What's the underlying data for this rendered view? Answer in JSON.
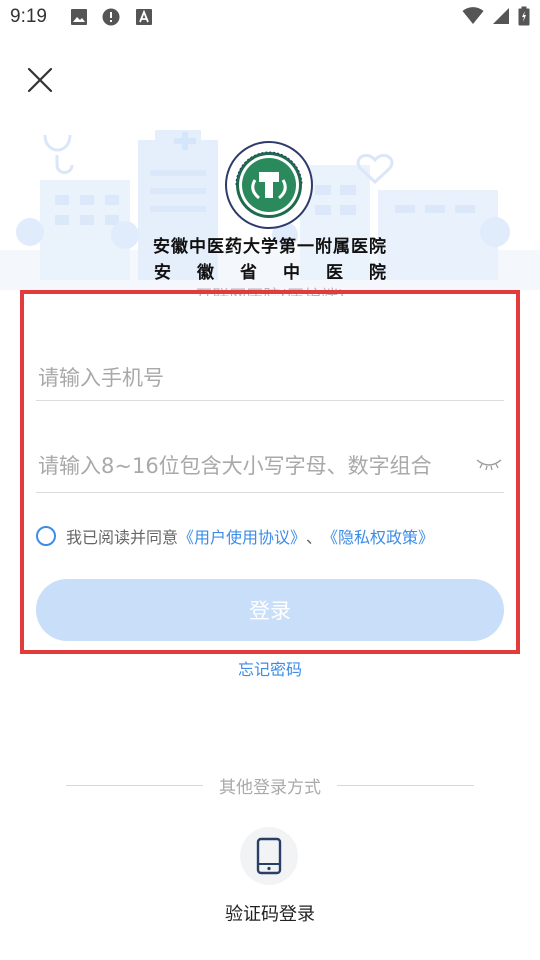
{
  "status_bar": {
    "time": "9:19",
    "left_icons": [
      "image-icon",
      "alert-icon",
      "a-icon"
    ],
    "right_icons": [
      "wifi-icon",
      "signal-icon",
      "battery-icon"
    ]
  },
  "header": {
    "close_icon": "close-icon"
  },
  "brand": {
    "logo_icon": "hospital-seal-logo",
    "name_line1": "安徽中医药大学第一附属医院",
    "name_line2": "安徽省中医院",
    "subtitle": "互联网医院(医护端)"
  },
  "form": {
    "phone_placeholder": "请输入手机号",
    "phone_value": "",
    "password_placeholder": "请输入8~16位包含大小写字母、数字组合",
    "password_value": "",
    "password_toggle_icon": "eye-closed-icon",
    "agree_prefix": "我已阅读并同意",
    "agree_link_user": "《用户使用协议》",
    "agree_sep": "、",
    "agree_link_privacy": "《隐私权政策》",
    "login_label": "登录",
    "forgot_label": "忘记密码"
  },
  "other_login": {
    "divider_text": "其他登录方式",
    "sms_icon": "phone-icon",
    "sms_label": "验证码登录"
  },
  "colors": {
    "accent": "#3d8ce8",
    "login_disabled": "#c9def9",
    "highlight_frame": "#e23b3b"
  }
}
